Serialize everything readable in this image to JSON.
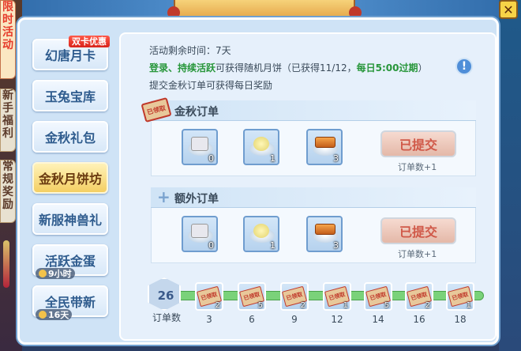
{
  "side_tabs": [
    {
      "label": [
        "限",
        "时",
        "活",
        "动"
      ],
      "active": true
    },
    {
      "label": [
        "新",
        "手",
        "福",
        "利"
      ],
      "active": false
    },
    {
      "label": [
        "常",
        "规",
        "奖",
        "励"
      ],
      "active": false
    }
  ],
  "close_label": "✕",
  "menu": [
    {
      "label": "幻唐月卡",
      "badge": "双卡优惠",
      "timer": "",
      "selected": false
    },
    {
      "label": "玉兔宝库",
      "badge": "",
      "timer": "",
      "selected": false
    },
    {
      "label": "金秋礼包",
      "badge": "",
      "timer": "",
      "selected": false
    },
    {
      "label": "金秋月饼坊",
      "badge": "",
      "timer": "",
      "selected": true
    },
    {
      "label": "新服神兽礼",
      "badge": "",
      "timer": "",
      "selected": false
    },
    {
      "label": "活跃金蛋",
      "badge": "",
      "timer": "9小时",
      "selected": false
    },
    {
      "label": "全民带新",
      "badge": "",
      "timer": "16天",
      "selected": false
    }
  ],
  "info": {
    "remaining_label": "活动剩余时间：7天",
    "line2_green1": "登录、持续活跃",
    "line2_mid": "可获得随机月饼（已获得11/12，",
    "line2_green2": "每日5:00过期",
    "line2_end": "）",
    "line3": "提交金秋订单可获得每日奖励",
    "help_icon": "!"
  },
  "sections": [
    {
      "title": "金秋订单",
      "icon": "stamp-icon",
      "items": [
        {
          "type": "white-mooncake",
          "count": "0"
        },
        {
          "type": "yellow-mooncake",
          "count": "1"
        },
        {
          "type": "orange-mooncake",
          "count": "3"
        }
      ],
      "button": "已提交",
      "order_count": "订单数+1"
    },
    {
      "title": "额外订单",
      "icon": "plus-icon",
      "items": [
        {
          "type": "white-mooncake",
          "count": "0"
        },
        {
          "type": "yellow-mooncake",
          "count": "1"
        },
        {
          "type": "orange-mooncake",
          "count": "3"
        }
      ],
      "button": "已提交",
      "order_count": "订单数+1"
    }
  ],
  "stamp_text": "已领取",
  "progress": {
    "value": "26",
    "label": "订单数",
    "milestones": [
      {
        "at": "3",
        "count": "2"
      },
      {
        "at": "6",
        "count": "5"
      },
      {
        "at": "9",
        "count": "2"
      },
      {
        "at": "12",
        "count": "1"
      },
      {
        "at": "14",
        "count": "5"
      },
      {
        "at": "16",
        "count": "2"
      },
      {
        "at": "18",
        "count": "1"
      }
    ]
  },
  "colors": {
    "accent": "#f4cf63",
    "green": "#27963a",
    "submit_text": "#d05848"
  }
}
